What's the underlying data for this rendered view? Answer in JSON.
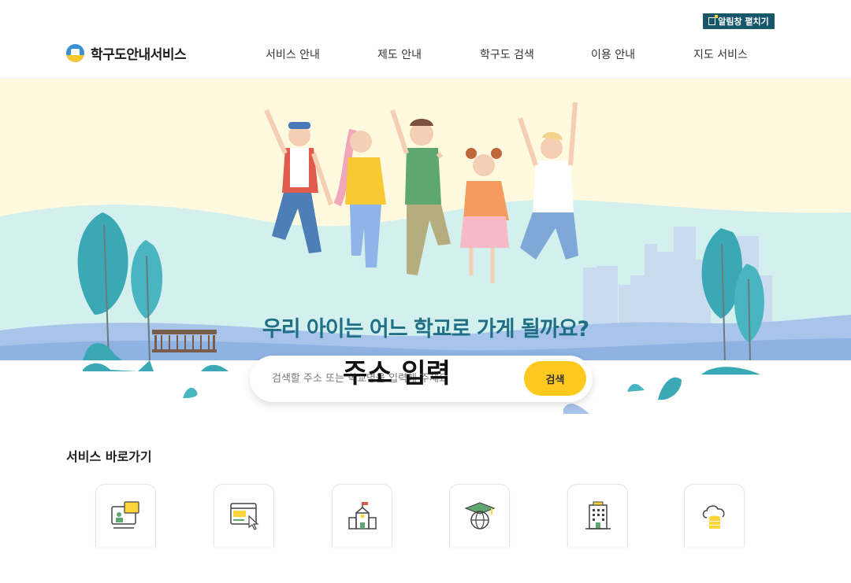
{
  "notice": {
    "label": "알림창 펼치기"
  },
  "header": {
    "logo_text": "학구도안내서비스",
    "nav": [
      {
        "label": "서비스 안내"
      },
      {
        "label": "제도 안내"
      },
      {
        "label": "학구도 검색"
      },
      {
        "label": "이용 안내"
      },
      {
        "label": "지도 서비스"
      }
    ]
  },
  "hero": {
    "title": "우리 아이는 어느 학교로 가게 될까요?"
  },
  "search": {
    "placeholder": "검색할 주소 또는 학교명을 입력해 주세요",
    "overlay_text": "주소 입력",
    "button_label": "검색"
  },
  "quick_links": {
    "title": "서비스 바로가기",
    "items": [
      {
        "icon": "monitor-consult-icon"
      },
      {
        "icon": "web-click-icon"
      },
      {
        "icon": "school-building-icon"
      },
      {
        "icon": "graduation-globe-icon"
      },
      {
        "icon": "office-building-icon"
      },
      {
        "icon": "cloud-database-icon"
      }
    ]
  },
  "colors": {
    "accent": "#17576b",
    "title": "#1f6f86",
    "search_button": "#ffc91f",
    "hero_bg": "#fff9e0"
  }
}
